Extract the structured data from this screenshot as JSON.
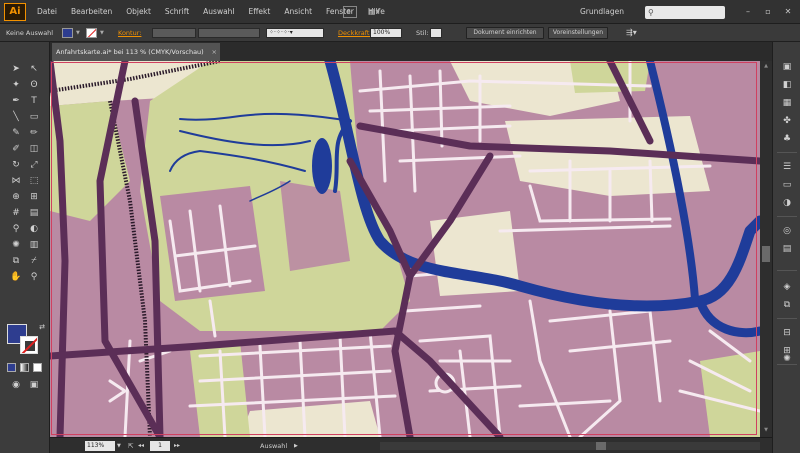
{
  "app": {
    "logo": "Ai",
    "menu": [
      "Datei",
      "Bearbeiten",
      "Objekt",
      "Schrift",
      "Auswahl",
      "Effekt",
      "Ansicht",
      "Fenster",
      "Hilfe"
    ],
    "bridge_label": "Br",
    "workspace": "Grundlagen",
    "search_placeholder": ""
  },
  "controlbar": {
    "selection_label": "Keine Auswahl",
    "fill_color": "#2e3d8f",
    "kontur_label": "Kontur:",
    "deckkraft_label": "Deckkraft:",
    "deckkraft_value": "100%",
    "stil_label": "Stil:",
    "doc_setup_button": "Dokument einrichten",
    "preferences_button": "Voreinstellungen"
  },
  "document": {
    "tab_title": "Anfahrtskarte.ai* bei 113 % (CMYK/Vorschau)",
    "close": "×"
  },
  "statusbar": {
    "zoom": "113%",
    "page": "1",
    "tool_status": "Auswahl"
  },
  "colors": {
    "map_pink": "#b98aa3",
    "map_green": "#cfd69a",
    "map_cream": "#ece6d0",
    "river_blue": "#1f3c9a",
    "main_road": "#5b2e57",
    "minor_road": "#f6eaf0"
  }
}
